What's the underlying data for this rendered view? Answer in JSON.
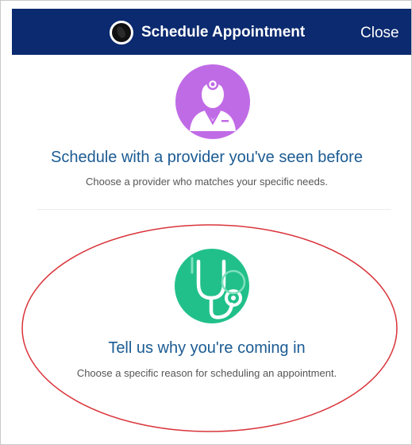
{
  "header": {
    "title": "Schedule Appointment",
    "close_label": "Close",
    "background_color": "#0b2a6f"
  },
  "options": [
    {
      "icon": "doctor-icon",
      "icon_color": "#c06be6",
      "title": "Schedule with a provider you've seen before",
      "subtitle": "Choose a provider who matches your specific needs."
    },
    {
      "icon": "stethoscope-icon",
      "icon_color": "#21c08a",
      "title": "Tell us why you're coming in",
      "subtitle": "Choose a specific reason for scheduling an appointment."
    }
  ],
  "annotation": {
    "shape": "ellipse",
    "color": "#d9343a"
  }
}
